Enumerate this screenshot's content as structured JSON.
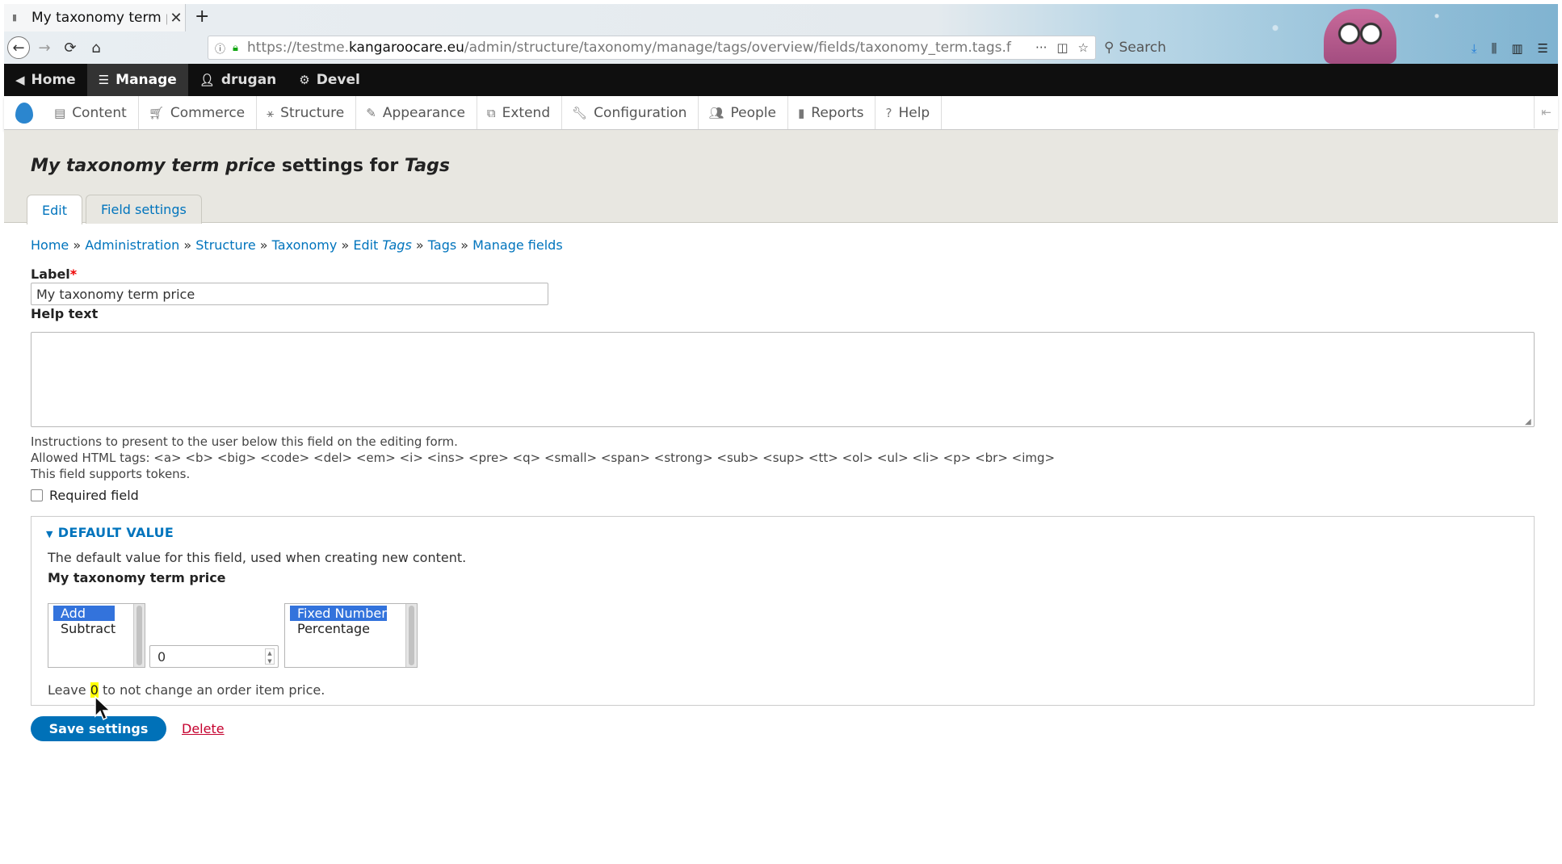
{
  "browser": {
    "tab_title": "My taxonomy term p",
    "tab_close": "✕",
    "new_tab": "+",
    "url_prefix": "https://testme.",
    "url_domain": "kangaroocare.eu",
    "url_path": "/admin/structure/taxonomy/manage/tags/overview/fields/taxonomy_term.tags.f",
    "search_placeholder": "Search",
    "more": "···"
  },
  "toolbar": {
    "home": "Home",
    "manage": "Manage",
    "user": "drugan",
    "devel": "Devel"
  },
  "admin_menu": [
    {
      "label": "Content",
      "icon": "file-icon"
    },
    {
      "label": "Commerce",
      "icon": "cart-icon"
    },
    {
      "label": "Structure",
      "icon": "sitemap-icon"
    },
    {
      "label": "Appearance",
      "icon": "brush-icon"
    },
    {
      "label": "Extend",
      "icon": "puzzle-icon"
    },
    {
      "label": "Configuration",
      "icon": "wrench-icon"
    },
    {
      "label": "People",
      "icon": "people-icon"
    },
    {
      "label": "Reports",
      "icon": "chart-icon"
    },
    {
      "label": "Help",
      "icon": "help-icon"
    }
  ],
  "page": {
    "title_field": "My taxonomy term price",
    "title_middle": " settings for ",
    "title_bundle": "Tags",
    "tabs": [
      "Edit",
      "Field settings"
    ]
  },
  "breadcrumb": {
    "items": [
      "Home",
      "Administration",
      "Structure",
      "Taxonomy",
      "Edit ",
      "Tags",
      "Tags",
      "Manage fields"
    ],
    "separator": " » "
  },
  "form": {
    "label_title": "Label",
    "required_mark": "*",
    "label_value": "My taxonomy term price",
    "help_title": "Help text",
    "help_desc_1": "Instructions to present to the user below this field on the editing form.",
    "help_desc_2": "Allowed HTML tags: <a> <b> <big> <code> <del> <em> <i> <ins> <pre> <q> <small> <span> <strong> <sub> <sup> <tt> <ol> <ul> <li> <p> <br> <img>",
    "help_desc_3": "This field supports tokens.",
    "required_label": "Required field",
    "required_checked": false
  },
  "default_value": {
    "summary": "DEFAULT VALUE",
    "description": "The default value for this field, used when creating new content.",
    "field_name": "My taxonomy term price",
    "operation_options": [
      "Add",
      "Subtract"
    ],
    "operation_selected": "Add",
    "amount": "0",
    "type_options": [
      "Fixed Number",
      "Percentage"
    ],
    "type_selected": "Fixed Number",
    "hint_before": "Leave ",
    "hint_mark": "0",
    "hint_after": " to not change an order item price."
  },
  "actions": {
    "save": "Save settings",
    "delete": "Delete"
  },
  "colors": {
    "link": "#0074bd",
    "primary_button": "#0071b8",
    "delete": "#c5002e",
    "toolbar": "#0f0f0f",
    "header_bg": "#e8e7e1"
  }
}
